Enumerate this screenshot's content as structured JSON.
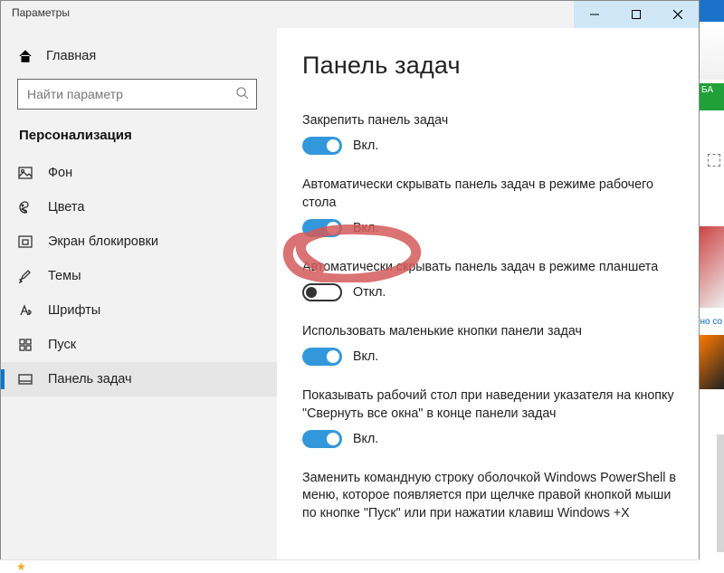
{
  "titlebar": {
    "title": "Параметры"
  },
  "sidebar": {
    "home": "Главная",
    "search_placeholder": "Найти параметр",
    "category": "Персонализация",
    "items": [
      {
        "label": "Фон"
      },
      {
        "label": "Цвета"
      },
      {
        "label": "Экран блокировки"
      },
      {
        "label": "Темы"
      },
      {
        "label": "Шрифты"
      },
      {
        "label": "Пуск"
      },
      {
        "label": "Панель задач"
      }
    ]
  },
  "page": {
    "title": "Панель задач",
    "settings": [
      {
        "label": "Закрепить панель задач",
        "state": "Вкл.",
        "on": true
      },
      {
        "label": "Автоматически скрывать панель задач в режиме рабочего стола",
        "state": "Вкл.",
        "on": true
      },
      {
        "label": "Автоматически скрывать панель задач в режиме планшета",
        "state": "Откл.",
        "on": false
      },
      {
        "label": "Использовать маленькие кнопки панели задач",
        "state": "Вкл.",
        "on": true
      },
      {
        "label": "Показывать рабочий стол при наведении указателя на кнопку \"Свернуть все окна\" в конце панели задач",
        "state": "Вкл.",
        "on": true
      },
      {
        "label": "Заменить командную строку оболочкой Windows PowerShell в меню, которое появляется при щелчке правой кнопкой мыши по кнопке \"Пуск\" или при нажатии клавиш Windows +X",
        "state": "",
        "on": null
      }
    ]
  },
  "bg_strip": {
    "green_text": "БА",
    "blue_text": "но\nсо"
  }
}
